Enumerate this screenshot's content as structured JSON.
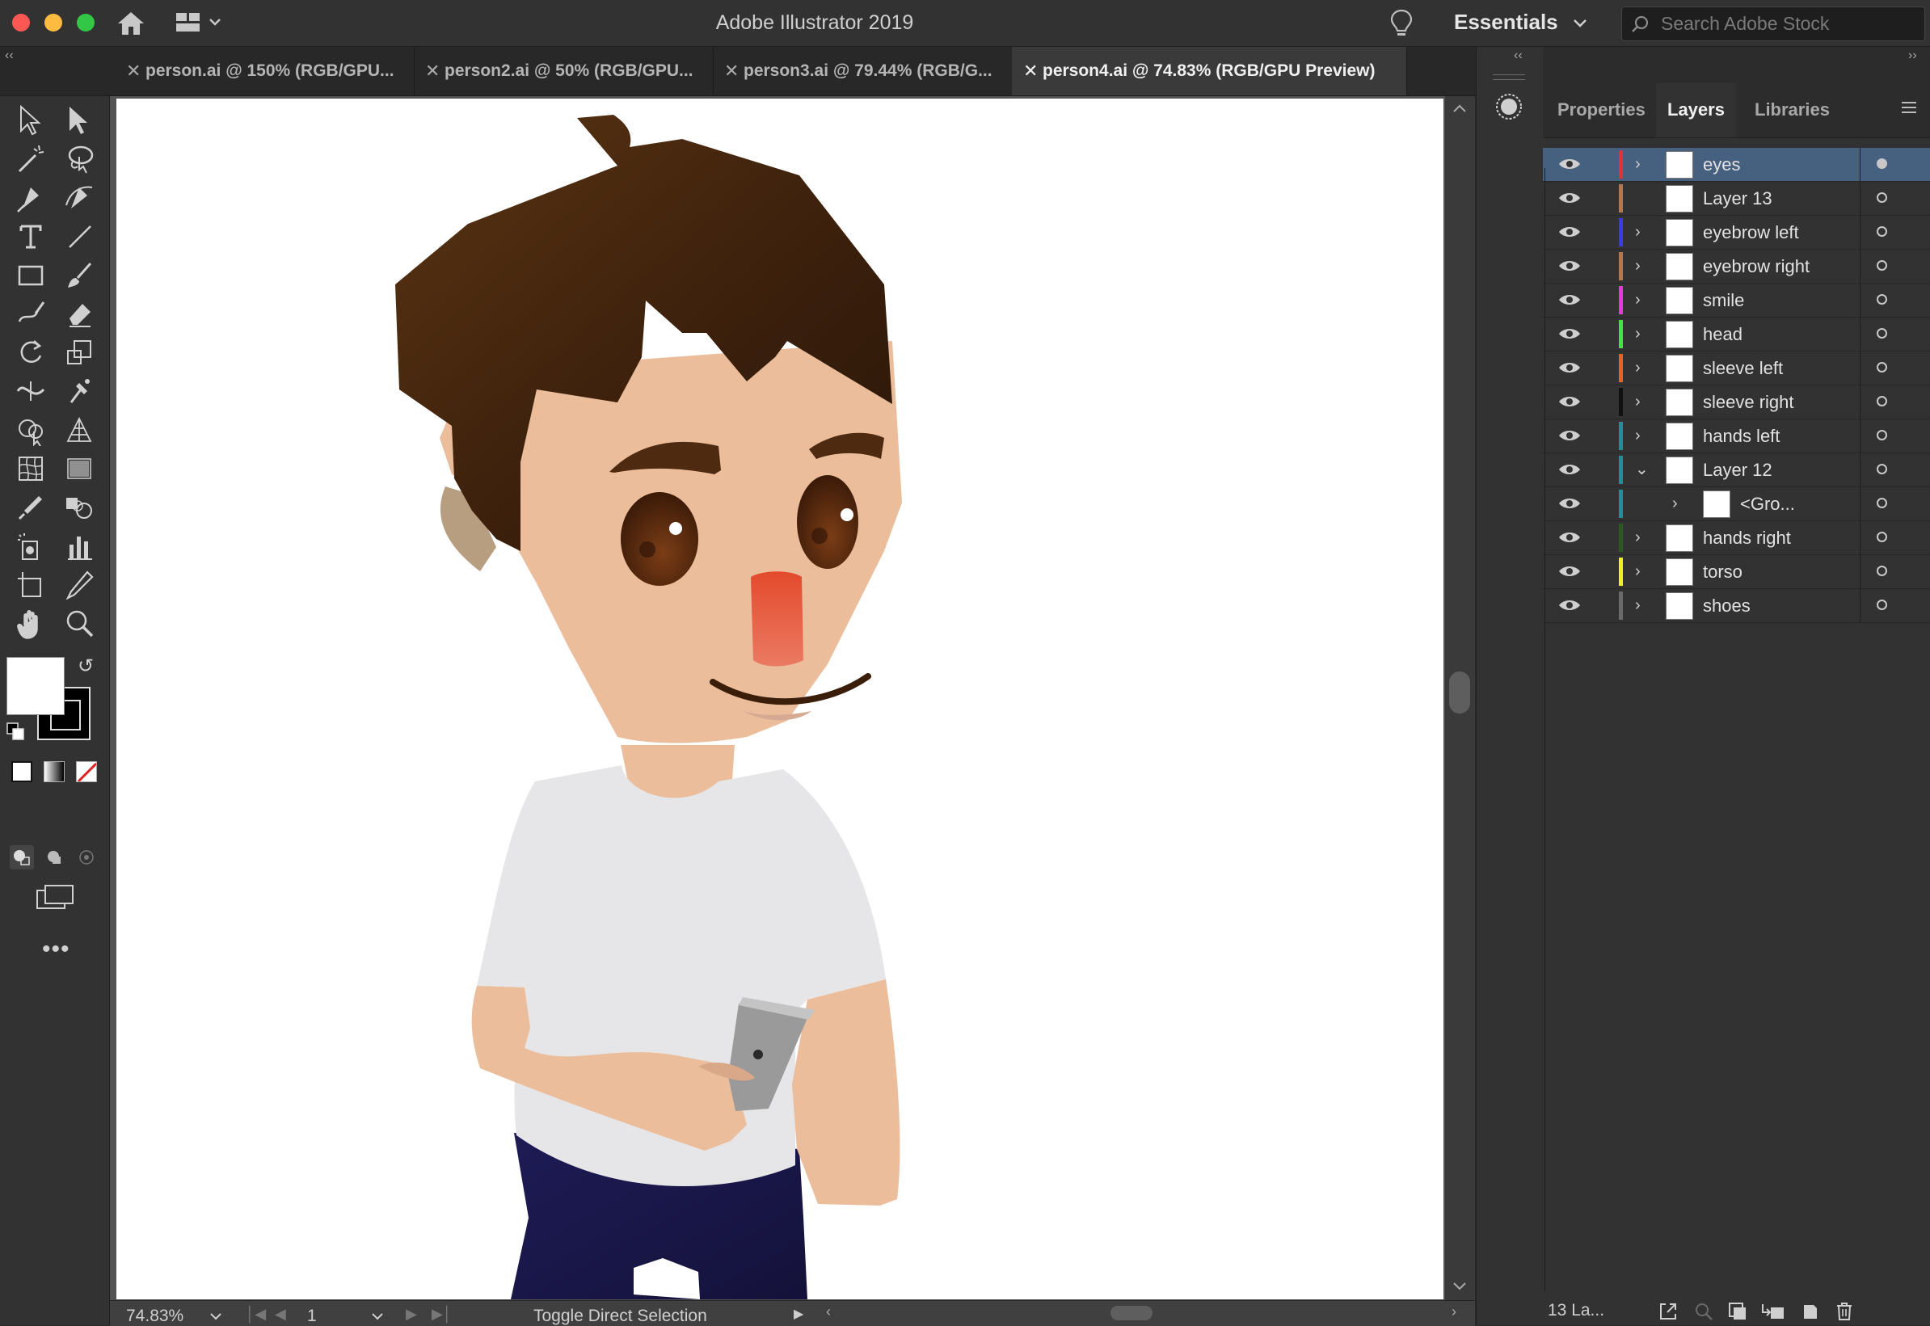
{
  "app": {
    "title": "Adobe Illustrator 2019",
    "workspace": "Essentials",
    "search_placeholder": "Search Adobe Stock"
  },
  "tabs": [
    {
      "label": "person.ai @ 150% (RGB/GPU..."
    },
    {
      "label": "person2.ai @ 50% (RGB/GPU..."
    },
    {
      "label": "person3.ai @ 79.44% (RGB/G..."
    },
    {
      "label": "person4.ai @ 74.83% (RGB/GPU Preview)",
      "active": true
    }
  ],
  "tools": [
    [
      "selection-tool-icon",
      "direct-selection-tool-icon"
    ],
    [
      "magic-wand-tool-icon",
      "lasso-tool-icon"
    ],
    [
      "pen-tool-icon",
      "curvature-tool-icon"
    ],
    [
      "type-tool-icon",
      "line-segment-tool-icon"
    ],
    [
      "rectangle-tool-icon",
      "paintbrush-tool-icon"
    ],
    [
      "shaper-tool-icon",
      "eraser-tool-icon"
    ],
    [
      "rotate-tool-icon",
      "scale-tool-icon"
    ],
    [
      "width-tool-icon",
      "puppet-warp-tool-icon"
    ],
    [
      "shape-builder-tool-icon",
      "perspective-grid-tool-icon"
    ],
    [
      "mesh-tool-icon",
      "gradient-tool-icon"
    ],
    [
      "eyedropper-tool-icon",
      "blend-tool-icon"
    ],
    [
      "symbol-sprayer-tool-icon",
      "column-graph-tool-icon"
    ],
    [
      "artboard-tool-icon",
      "slice-tool-icon"
    ],
    [
      "hand-tool-icon",
      "zoom-tool-icon"
    ]
  ],
  "status": {
    "zoom": "74.83%",
    "artboard_number": "1",
    "tool_hint": "Toggle Direct Selection"
  },
  "panel": {
    "tabs": [
      "Properties",
      "Layers",
      "Libraries"
    ],
    "active_tab": "Layers",
    "layer_count": "13 La..."
  },
  "layers": [
    {
      "name": "eyes",
      "color": "#e03434",
      "expander": "collapsed",
      "selected": true
    },
    {
      "name": "Layer 13",
      "color": "#b8774a",
      "expander": "none"
    },
    {
      "name": "eyebrow left",
      "color": "#3a3ae8",
      "expander": "collapsed"
    },
    {
      "name": "eyebrow right",
      "color": "#b8774a",
      "expander": "collapsed"
    },
    {
      "name": "smile",
      "color": "#e636e6",
      "expander": "collapsed"
    },
    {
      "name": "head",
      "color": "#3fe63f",
      "expander": "collapsed"
    },
    {
      "name": "sleeve left",
      "color": "#e8641e",
      "expander": "collapsed"
    },
    {
      "name": "sleeve right",
      "color": "#111111",
      "expander": "collapsed"
    },
    {
      "name": "hands left",
      "color": "#1f8f99",
      "expander": "collapsed"
    },
    {
      "name": "Layer 12",
      "color": "#1f8f99",
      "expander": "expanded"
    },
    {
      "name": "<Gro...",
      "color": "#1f8f99",
      "expander": "collapsed",
      "child": true
    },
    {
      "name": "hands right",
      "color": "#2a5a1e",
      "expander": "collapsed"
    },
    {
      "name": "torso",
      "color": "#f0f020",
      "expander": "collapsed"
    },
    {
      "name": "shoes",
      "color": "#6a6a6a",
      "expander": "collapsed"
    }
  ],
  "colors": {
    "hair": "#4a2a12",
    "skin": "#ebbd9b",
    "shirt": "#e6e6e8",
    "pants": "#1d1a50",
    "nose": "#e85a3c",
    "eye": "#4a220e",
    "phone": "#9a9a9a",
    "selection": "#46607f"
  }
}
